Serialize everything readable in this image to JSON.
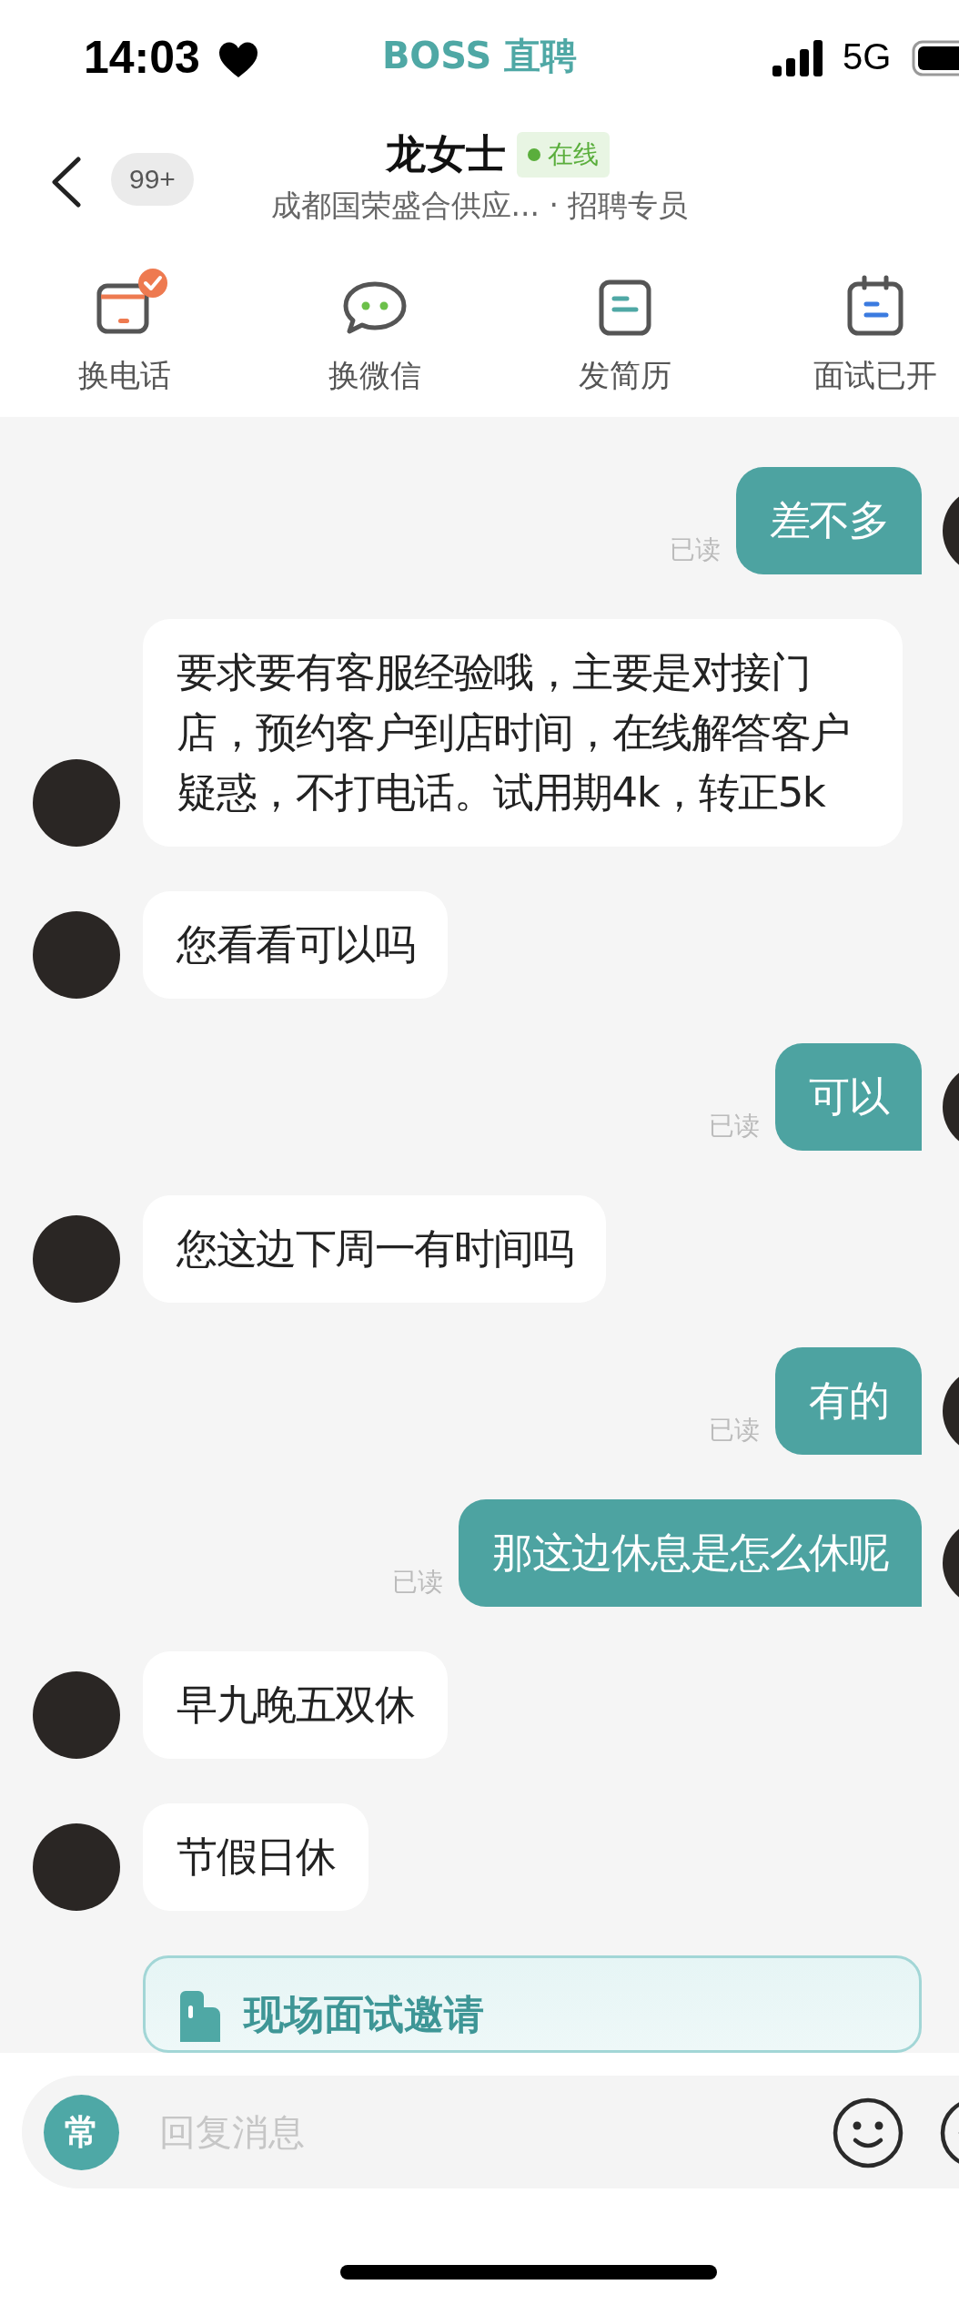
{
  "status_bar": {
    "time": "14:03",
    "app_name": "BOSS 直聘",
    "network": "5G"
  },
  "header": {
    "unread_count": "99+",
    "name": "龙女士",
    "presence": "在线",
    "subtitle": "成都国荣盛合供应... · 招聘专员"
  },
  "actions": [
    {
      "kind": "phone",
      "label": "换电话",
      "checked": true
    },
    {
      "kind": "wechat",
      "label": "换微信",
      "checked": false
    },
    {
      "kind": "resume",
      "label": "发简历",
      "checked": false
    },
    {
      "kind": "interview",
      "label": "面试已开",
      "checked": false
    }
  ],
  "messages": [
    {
      "kind": "sent",
      "text": "差不多",
      "status": "已读"
    },
    {
      "kind": "received",
      "text": "要求要有客服经验哦，主要是对接门店，预约客户到店时间，在线解答客户疑惑，不打电话。试用期4k，转正5k"
    },
    {
      "kind": "received",
      "text": "您看看可以吗"
    },
    {
      "kind": "sent",
      "text": "可以",
      "status": "已读"
    },
    {
      "kind": "received",
      "text": "您这边下周一有时间吗"
    },
    {
      "kind": "sent",
      "text": "有的",
      "status": "已读"
    },
    {
      "kind": "sent",
      "text": "那这边休息是怎么休呢",
      "status": "已读"
    },
    {
      "kind": "received",
      "text": "早九晚五双休"
    },
    {
      "kind": "received",
      "text": "节假日休"
    },
    {
      "kind": "card",
      "text": "现场面试邀请"
    }
  ],
  "input_bar": {
    "quick_reply": "常",
    "placeholder": "回复消息"
  }
}
